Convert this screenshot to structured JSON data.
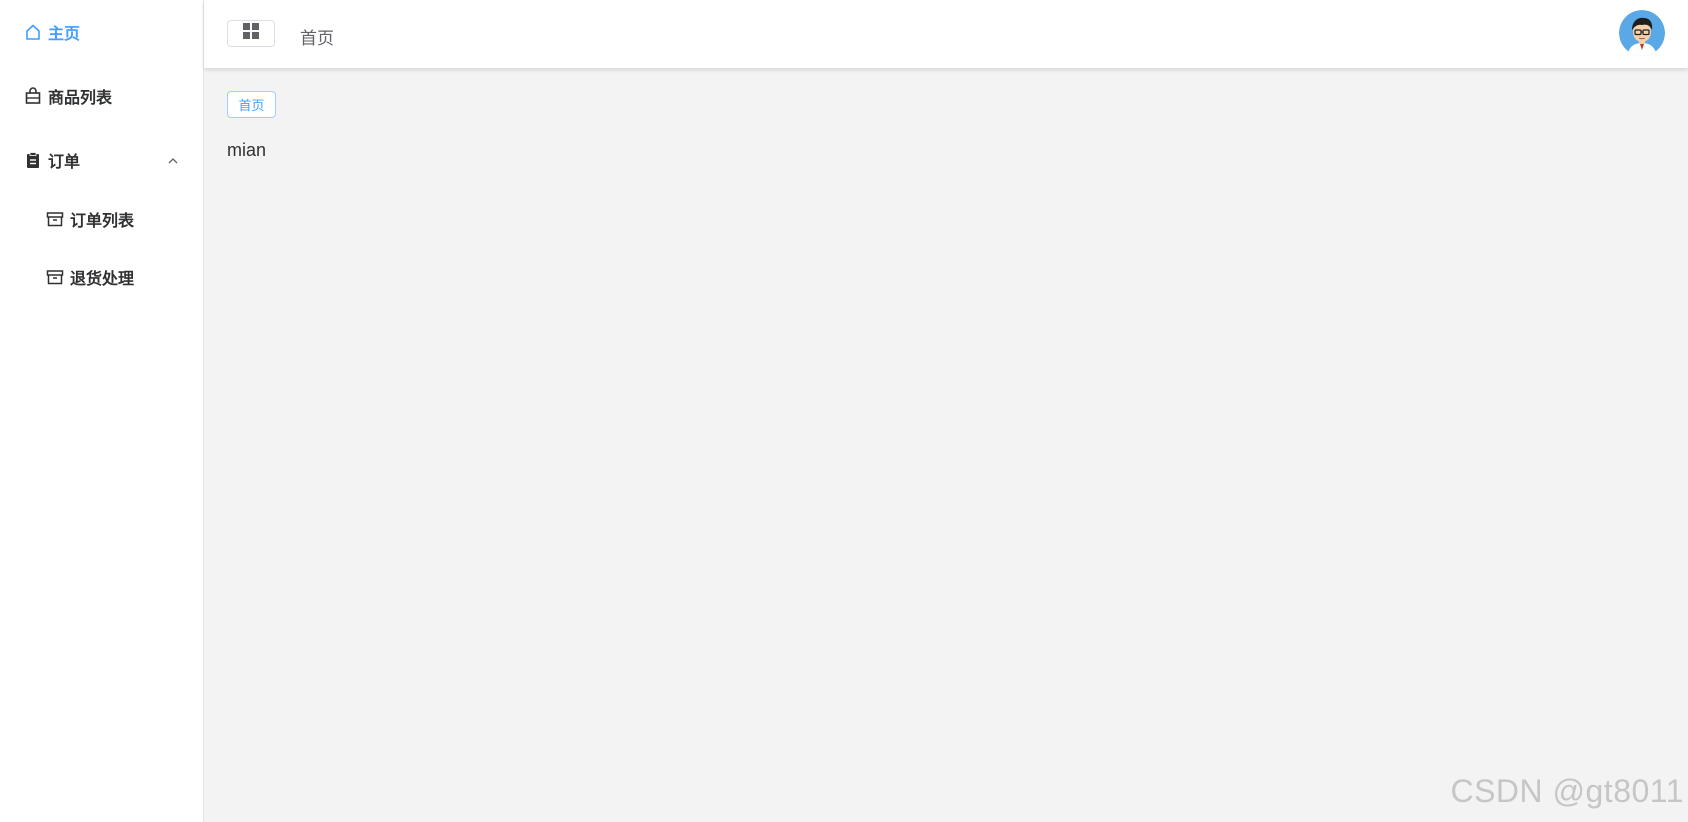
{
  "sidebar": {
    "items": [
      {
        "label": "主页",
        "icon": "home-icon",
        "active": true
      },
      {
        "label": "商品列表",
        "icon": "shopping-bag-icon"
      },
      {
        "label": "订单",
        "icon": "clipboard-icon",
        "expanded": true
      },
      {
        "label": "订单列表",
        "icon": "box-icon"
      },
      {
        "label": "退货处理",
        "icon": "box-icon"
      }
    ]
  },
  "header": {
    "collapse_icon": "grid-icon",
    "title": "首页",
    "avatar": "avatar-icon"
  },
  "main": {
    "tags": [
      {
        "label": "首页"
      }
    ],
    "content": "mian"
  },
  "watermark": "CSDN @gt8011",
  "colors": {
    "accent": "#409eff",
    "text": "#303133",
    "background": "#f3f3f3",
    "sidebar_bg": "#ffffff"
  }
}
